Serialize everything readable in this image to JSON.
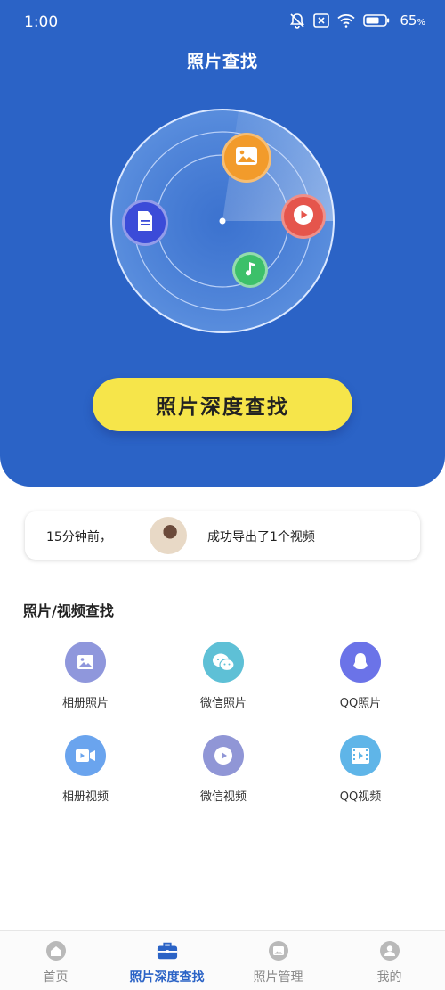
{
  "status_bar": {
    "time": "1:00",
    "battery": "65",
    "battery_unit": "%",
    "icons": [
      "bell-off-icon",
      "no-sim-icon",
      "wifi-icon",
      "battery-icon"
    ]
  },
  "header": {
    "title": "照片查找"
  },
  "radar": {
    "nodes": [
      "photo-icon",
      "video-play-icon",
      "document-icon",
      "music-icon"
    ]
  },
  "search_button": {
    "label": "照片深度查找"
  },
  "notice": {
    "time": "15分钟前，",
    "message": "成功导出了1个视频"
  },
  "section": {
    "title": "照片/视频查找"
  },
  "grid": [
    {
      "label": "相册照片",
      "icon": "album-photo-icon",
      "color": "#8f97dc"
    },
    {
      "label": "微信照片",
      "icon": "wechat-icon",
      "color": "#5ec0d6"
    },
    {
      "label": "QQ照片",
      "icon": "qq-icon",
      "color": "#6b73e8"
    },
    {
      "label": "相册视频",
      "icon": "video-camera-icon",
      "color": "#6aa4ee"
    },
    {
      "label": "微信视频",
      "icon": "play-circle-icon",
      "color": "#9096d6"
    },
    {
      "label": "QQ视频",
      "icon": "film-icon",
      "color": "#5fb5e8"
    }
  ],
  "tabbar": {
    "tabs": [
      {
        "label": "首页",
        "icon": "home-icon",
        "active": false
      },
      {
        "label": "照片深度查找",
        "icon": "briefcase-icon",
        "active": true
      },
      {
        "label": "照片管理",
        "icon": "image-manage-icon",
        "active": false
      },
      {
        "label": "我的",
        "icon": "profile-icon",
        "active": false
      }
    ]
  },
  "colors": {
    "primary": "#2b63c6",
    "button": "#f6e54a",
    "tab_active": "#2b63c6",
    "tab_inactive": "#8a8a8a"
  }
}
